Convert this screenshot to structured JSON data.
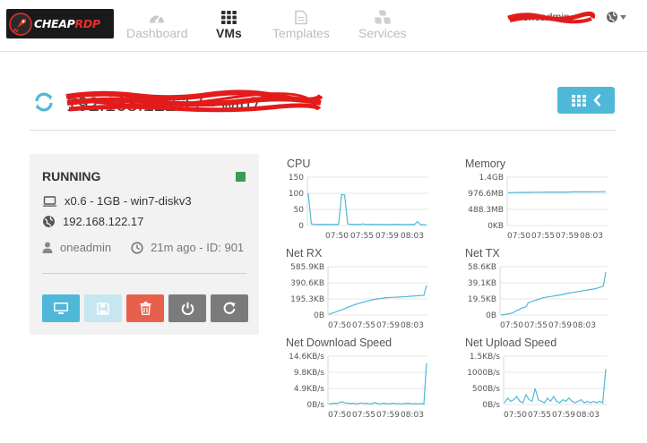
{
  "brand": {
    "name_part1": "CHEAP",
    "name_part2": "RDP",
    "accent_color": "#e8302a"
  },
  "nav": [
    {
      "label": "Dashboard",
      "icon": "dashboard-icon",
      "active": false
    },
    {
      "label": "VMs",
      "icon": "grid-icon",
      "active": true
    },
    {
      "label": "Templates",
      "icon": "file-icon",
      "active": false
    },
    {
      "label": "Services",
      "icon": "cubes-icon",
      "active": false
    }
  ],
  "user": {
    "name": "oneadmin",
    "redacted": true
  },
  "vm": {
    "title": "192.168.122.17 - win7",
    "state": "RUNNING",
    "state_color": "#3b9c55",
    "capacity": "x0.6 - 1GB - win7-diskv3",
    "ip": "192.168.122.17",
    "owner": "oneadmin",
    "age_id": "21m ago - ID: 901"
  },
  "actions": [
    {
      "name": "vnc-button",
      "icon": "monitor-icon",
      "color": "#4fb8d9"
    },
    {
      "name": "save-button",
      "icon": "floppy-icon",
      "color": "#c6e6f0"
    },
    {
      "name": "delete-button",
      "icon": "trash-icon",
      "color": "#e8604c"
    },
    {
      "name": "power-button",
      "icon": "power-icon",
      "color": "#7b7b7b"
    },
    {
      "name": "reboot-button",
      "icon": "refresh-icon",
      "color": "#7b7b7b"
    }
  ],
  "accent": "#4fb8d9",
  "chart_data": [
    {
      "title": "CPU",
      "type": "line",
      "yticks": [
        "150",
        "100",
        "50",
        "0"
      ],
      "xticks": [
        "07:50",
        "07:55",
        "07:59",
        "08:03"
      ],
      "ylim": [
        0,
        150
      ],
      "values": [
        100,
        5,
        4,
        3,
        4,
        3,
        4,
        3,
        3,
        4,
        3,
        96,
        95,
        5,
        4,
        3,
        4,
        3,
        5,
        3,
        3,
        4,
        3,
        3,
        4,
        3,
        3,
        3,
        4,
        3,
        4,
        3,
        3,
        3,
        4,
        3,
        12,
        3,
        3,
        2
      ]
    },
    {
      "title": "Memory",
      "type": "line",
      "yticks": [
        "1.4GB",
        "976.6MB",
        "488.3MB",
        "0KB"
      ],
      "xticks": [
        "07:50",
        "07:55",
        "07:59",
        "08:03"
      ],
      "ylim": [
        0,
        1.4
      ],
      "values": [
        0.95,
        0.955,
        0.96,
        0.96,
        0.965,
        0.965,
        0.97,
        0.97,
        0.97,
        0.97,
        0.975,
        0.975,
        0.975,
        0.975,
        0.98,
        0.98
      ]
    },
    {
      "title": "Net RX",
      "type": "line",
      "yticks": [
        "585.9KB",
        "390.6KB",
        "195.3KB",
        "0B"
      ],
      "xticks": [
        "07:50",
        "07:55",
        "07:59",
        "08:03"
      ],
      "ylim": [
        0,
        585.9
      ],
      "values": [
        10,
        20,
        30,
        45,
        55,
        65,
        80,
        95,
        105,
        120,
        130,
        140,
        150,
        160,
        170,
        175,
        185,
        190,
        195,
        200,
        205,
        210,
        212,
        214,
        215,
        216,
        218,
        220,
        222,
        225,
        228,
        230,
        232,
        234,
        236,
        238,
        360
      ]
    },
    {
      "title": "Net TX",
      "type": "line",
      "yticks": [
        "58.6KB",
        "39.1KB",
        "19.5KB",
        "0B"
      ],
      "xticks": [
        "07:50",
        "07:55",
        "07:59",
        "08:03"
      ],
      "ylim": [
        0,
        58.6
      ],
      "values": [
        0,
        0.5,
        1,
        1.5,
        2,
        3,
        5,
        6,
        8,
        9,
        10,
        15,
        16,
        17,
        18,
        19,
        20,
        21,
        21.5,
        22,
        22.5,
        23,
        23.5,
        24,
        24.5,
        25,
        26,
        26.5,
        27,
        27.5,
        28,
        28.5,
        29,
        29.5,
        30,
        30.5,
        31,
        31.5,
        32,
        33,
        34,
        35,
        52
      ]
    },
    {
      "title": "Net Download Speed",
      "type": "line",
      "yticks": [
        "14.6KB/s",
        "9.8KB/s",
        "4.9KB/s",
        "0B/s"
      ],
      "xticks": [
        "07:50",
        "07:55",
        "07:59",
        "08:03"
      ],
      "ylim": [
        0,
        14.6
      ],
      "values": [
        0.2,
        0.3,
        0.4,
        0.3,
        0.6,
        0.8,
        0.5,
        0.4,
        0.3,
        0.4,
        0.2,
        0.3,
        0.5,
        0.3,
        0.4,
        0.2,
        0.3,
        0.6,
        0.3,
        0.2,
        0.4,
        0.3,
        0.2,
        0.3,
        0.4,
        0.2,
        0.3,
        0.2,
        0.3,
        0.4,
        0.3,
        0.2,
        0.3,
        0.2,
        0.3,
        0.2,
        12.5
      ]
    },
    {
      "title": "Net Upload Speed",
      "type": "line",
      "yticks": [
        "1.5KB/s",
        "1000B/s",
        "500B/s",
        "0B/s"
      ],
      "xticks": [
        "07:50",
        "07:55",
        "07:59",
        "08:03"
      ],
      "ylim": [
        0,
        1.5
      ],
      "values": [
        0.05,
        0.2,
        0.1,
        0.15,
        0.25,
        0.1,
        0.05,
        0.3,
        0.15,
        0.1,
        0.5,
        0.15,
        0.1,
        0.05,
        0.2,
        0.1,
        0.25,
        0.1,
        0.05,
        0.15,
        0.1,
        0.2,
        0.1,
        0.05,
        0.1,
        0.15,
        0.05,
        0.1,
        0.05,
        0.1,
        0.05,
        0.1,
        0.05,
        1.1
      ]
    }
  ]
}
